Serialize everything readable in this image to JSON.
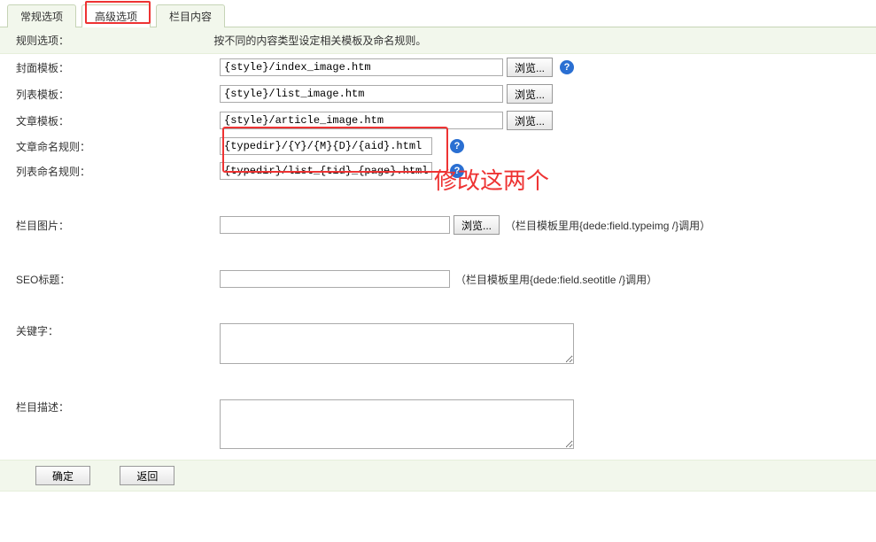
{
  "tabs": {
    "tab1": "常规选项",
    "tab2": "高级选项",
    "tab3": "栏目内容"
  },
  "rule": {
    "label": "规则选项：",
    "desc": "按不同的内容类型设定相关模板及命名规则。"
  },
  "fields": {
    "cover_tpl": {
      "label": "封面模板：",
      "value": "{style}/index_image.htm",
      "browse": "浏览..."
    },
    "list_tpl": {
      "label": "列表模板：",
      "value": "{style}/list_image.htm",
      "browse": "浏览..."
    },
    "article_tpl": {
      "label": "文章模板：",
      "value": "{style}/article_image.htm",
      "browse": "浏览..."
    },
    "article_rule": {
      "label": "文章命名规则：",
      "value": "{typedir}/{Y}/{M}{D}/{aid}.html"
    },
    "list_rule": {
      "label": "列表命名规则：",
      "value": "{typedir}/list_{tid}_{page}.html"
    },
    "col_image": {
      "label": "栏目图片：",
      "value": "",
      "browse": "浏览...",
      "hint": "（栏目模板里用{dede:field.typeimg /}调用）"
    },
    "seo_title": {
      "label": "SEO标题：",
      "value": "",
      "hint": "（栏目模板里用{dede:field.seotitle /}调用）"
    },
    "keywords": {
      "label": "关键字：",
      "value": ""
    },
    "col_desc": {
      "label": "栏目描述：",
      "value": ""
    }
  },
  "annotation": "修改这两个",
  "buttons": {
    "ok": "确定",
    "back": "返回"
  },
  "help_icon": "?"
}
